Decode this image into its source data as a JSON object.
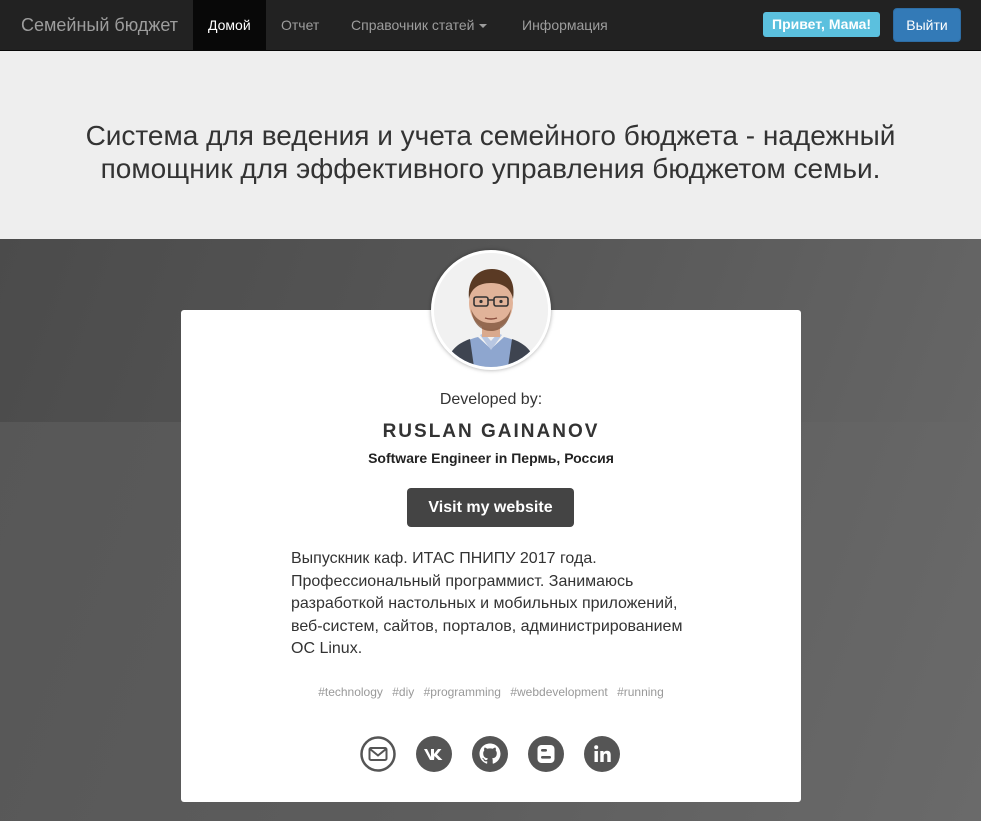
{
  "navbar": {
    "brand": "Семейный бюджет",
    "items": [
      {
        "label": "Домой"
      },
      {
        "label": "Отчет"
      },
      {
        "label": "Справочник статей"
      },
      {
        "label": "Информация"
      }
    ],
    "greeting": "Привет, Мама!",
    "logout": "Выйти"
  },
  "hero": {
    "title": "Система для ведения и учета семейного бюджета - надежный помощник для эффективного управления бюджетом семьи."
  },
  "card": {
    "developed_by": "Developed by:",
    "name": "RUSLAN GAINANOV",
    "role": "Software Engineer in Пермь, Россия",
    "visit_button": "Visit my website",
    "bio": "Выпускник каф. ИТАС ПНИПУ 2017 года. Профессиональный программист. Занимаюсь разработкой настольных и мобильных приложений, веб-систем, сайтов, порталов, администрированием ОС Linux.",
    "tags": [
      "#technology",
      "#diy",
      "#programming",
      "#webdevelopment",
      "#running"
    ],
    "social_icons": [
      "email-icon",
      "vk-icon",
      "github-icon",
      "blogger-icon",
      "linkedin-icon"
    ]
  },
  "colors": {
    "navbar_bg": "#222222",
    "greeting_badge": "#5bc0de",
    "logout_button": "#337ab7",
    "visit_button": "#444444",
    "hero_bg": "#eeeeee"
  }
}
